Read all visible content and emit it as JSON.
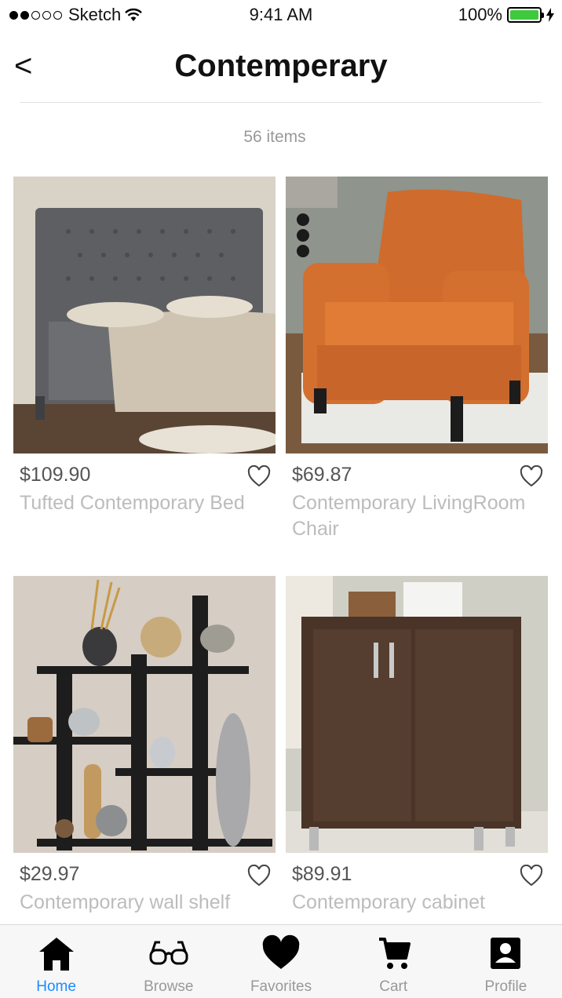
{
  "status_bar": {
    "carrier": "Sketch",
    "time": "9:41 AM",
    "battery": "100%",
    "battery_level": 1.0,
    "signal_bars_filled": 2,
    "signal_bars_total": 5
  },
  "nav": {
    "back_label": "<",
    "title": "Contemperary"
  },
  "item_count": "56 items",
  "products": [
    {
      "price": "$109.90",
      "name": "Tufted Contemporary Bed",
      "image": "gray-tufted-bed"
    },
    {
      "price": "$69.87",
      "name": "Contemporary LivingRoom Chair",
      "image": "orange-armchair"
    },
    {
      "price": "$29.97",
      "name": "Contemporary wall shelf",
      "image": "dark-wall-shelf"
    },
    {
      "price": "$89.91",
      "name": "Contemporary cabinet",
      "image": "wood-cabinet"
    }
  ],
  "tabs": [
    {
      "label": "Home",
      "icon": "house-icon",
      "active": true
    },
    {
      "label": "Browse",
      "icon": "glasses-icon",
      "active": false
    },
    {
      "label": "Favorites",
      "icon": "heart-icon",
      "active": false
    },
    {
      "label": "Cart",
      "icon": "cart-icon",
      "active": false
    },
    {
      "label": "Profile",
      "icon": "profile-icon",
      "active": false
    }
  ],
  "colors": {
    "accent": "#1a8cff",
    "battery": "#3ec93e",
    "muted_text": "#999999",
    "name_text": "#bcbcbc"
  }
}
